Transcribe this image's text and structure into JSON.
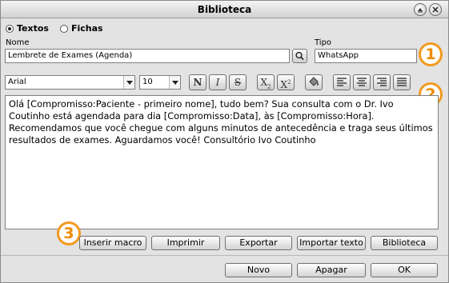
{
  "window": {
    "title": "Biblioteca"
  },
  "mode": {
    "options": [
      {
        "label": "Textos",
        "selected": true
      },
      {
        "label": "Fichas",
        "selected": false
      }
    ]
  },
  "form": {
    "nome_label": "Nome",
    "nome_value": "Lembrete de Exames (Agenda)",
    "tipo_label": "Tipo",
    "tipo_value": "WhatsApp"
  },
  "toolbar": {
    "font": "Arial",
    "size": "10",
    "buttons": {
      "bold": "N",
      "italic": "I",
      "strike": "S",
      "subscript": "X",
      "subscript_mark": "2",
      "superscript": "X",
      "superscript_mark": "2"
    }
  },
  "editor": {
    "text": "Olá [Compromisso:Paciente - primeiro nome], tudo bem? Sua consulta com o Dr. Ivo Coutinho está agendada para dia [Compromisso:Data], às [Compromisso:Hora]. Recomendamos que você chegue com alguns minutos de antecedência e traga seus últimos resultados de exames. Aguardamos você! Consultório Ivo Coutinho"
  },
  "actions": {
    "inserir_macro": "Inserir macro",
    "imprimir": "Imprimir",
    "exportar": "Exportar",
    "importar_texto": "Importar texto",
    "biblioteca": "Biblioteca"
  },
  "footer": {
    "novo": "Novo",
    "apagar": "Apagar",
    "ok": "OK"
  },
  "callouts": {
    "one": "1",
    "two": "2",
    "three": "3"
  },
  "colors": {
    "callout": "#f39a1f",
    "window_bg": "#e3e3e3"
  }
}
